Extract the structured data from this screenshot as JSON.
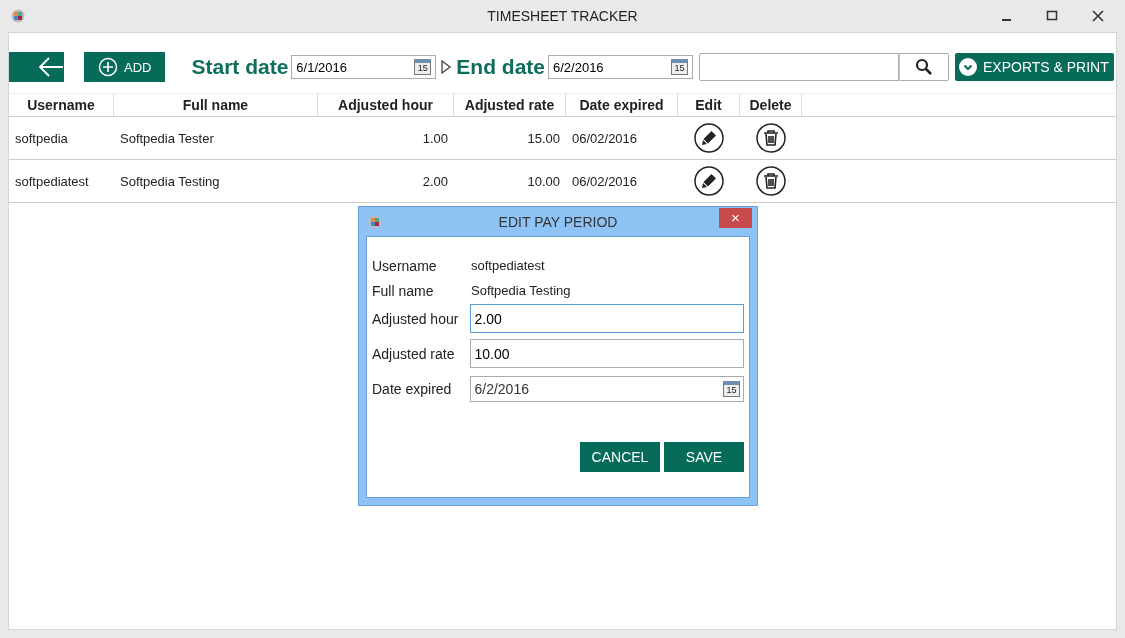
{
  "window": {
    "title": "TIMESHEET TRACKER"
  },
  "toolbar": {
    "add_label": "ADD",
    "start_label": "Start date",
    "start_value": "6/1/2016",
    "end_label": "End date",
    "end_value": "6/2/2016",
    "start_calendar_day": "15",
    "end_calendar_day": "15",
    "exports_label": "EXPORTS & PRINT"
  },
  "table": {
    "columns": [
      "Username",
      "Full name",
      "Adjusted hour",
      "Adjusted rate",
      "Date expired",
      "Edit",
      "Delete"
    ],
    "rows": [
      {
        "username": "softpedia",
        "full_name": "Softpedia Tester",
        "adjusted_hour": "1.00",
        "adjusted_rate": "15.00",
        "date_expired": "06/02/2016"
      },
      {
        "username": "softpediatest",
        "full_name": "Softpedia Testing",
        "adjusted_hour": "2.00",
        "adjusted_rate": "10.00",
        "date_expired": "06/02/2016"
      }
    ]
  },
  "dialog": {
    "title": "EDIT PAY PERIOD",
    "close": "×",
    "fields": [
      {
        "kind": "static",
        "label": "Username",
        "value": "softpediatest"
      },
      {
        "kind": "static",
        "label": "Full name",
        "value": "Softpedia Testing"
      },
      {
        "kind": "input",
        "label": "Adjusted hour",
        "value": "2.00",
        "focused": true
      },
      {
        "kind": "input",
        "label": "Adjusted rate",
        "value": "10.00",
        "focused": false
      },
      {
        "kind": "date",
        "label": "Date expired",
        "value": "6/2/2016",
        "calendar_day": "15",
        "focused": false
      }
    ],
    "buttons": [
      "CANCEL",
      "SAVE"
    ]
  }
}
